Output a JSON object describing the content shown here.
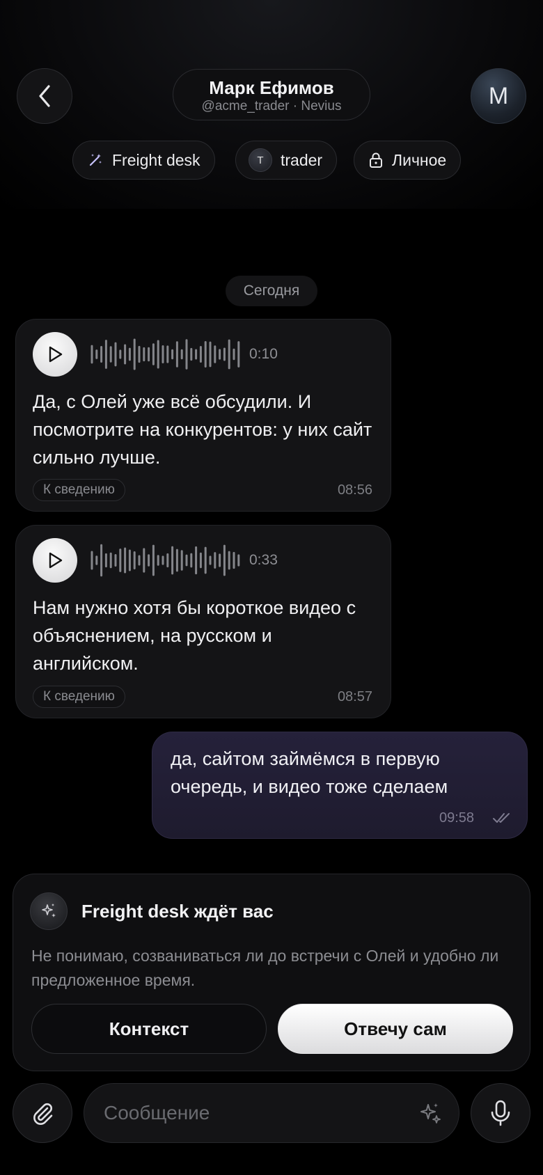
{
  "header": {
    "name": "Марк Ефимов",
    "subtitle": "@acme_trader · Nevius",
    "avatar_letter": "M"
  },
  "chips": [
    {
      "label": "Freight desk",
      "icon": "magic-wand-icon"
    },
    {
      "label": "trader",
      "icon_letter": "T"
    },
    {
      "label": "Личное",
      "icon": "lock-icon"
    }
  ],
  "date_separator": "Сегодня",
  "messages": [
    {
      "type": "voice",
      "duration": "0:10",
      "text": "Да, с Олей уже всё обсудили. И посмотрите на конкурентов: у них сайт сильно лучше.",
      "tag": "К сведению",
      "time": "08:56"
    },
    {
      "type": "voice",
      "duration": "0:33",
      "text": "Нам нужно хотя бы короткое видео с объяснением, на русском и английском.",
      "tag": "К сведению",
      "time": "08:57"
    },
    {
      "type": "outgoing",
      "text": "да, сайтом займёмся в первую очередь, и видео тоже сделаем",
      "time": "09:58",
      "status_icon": "double-check-icon"
    }
  ],
  "assistant_card": {
    "title": "Freight desk ждёт вас",
    "body": "Не понимаю, созваниваться ли до встречи с Олей и удобно ли предложенное время.",
    "context_button": "Контекст",
    "self_button": "Отвечу сам"
  },
  "composer": {
    "placeholder": "Сообщение"
  },
  "colors": {
    "background": "#000000",
    "outgoing_bubble": "#25213a",
    "incoming_bubble": "#141416"
  }
}
